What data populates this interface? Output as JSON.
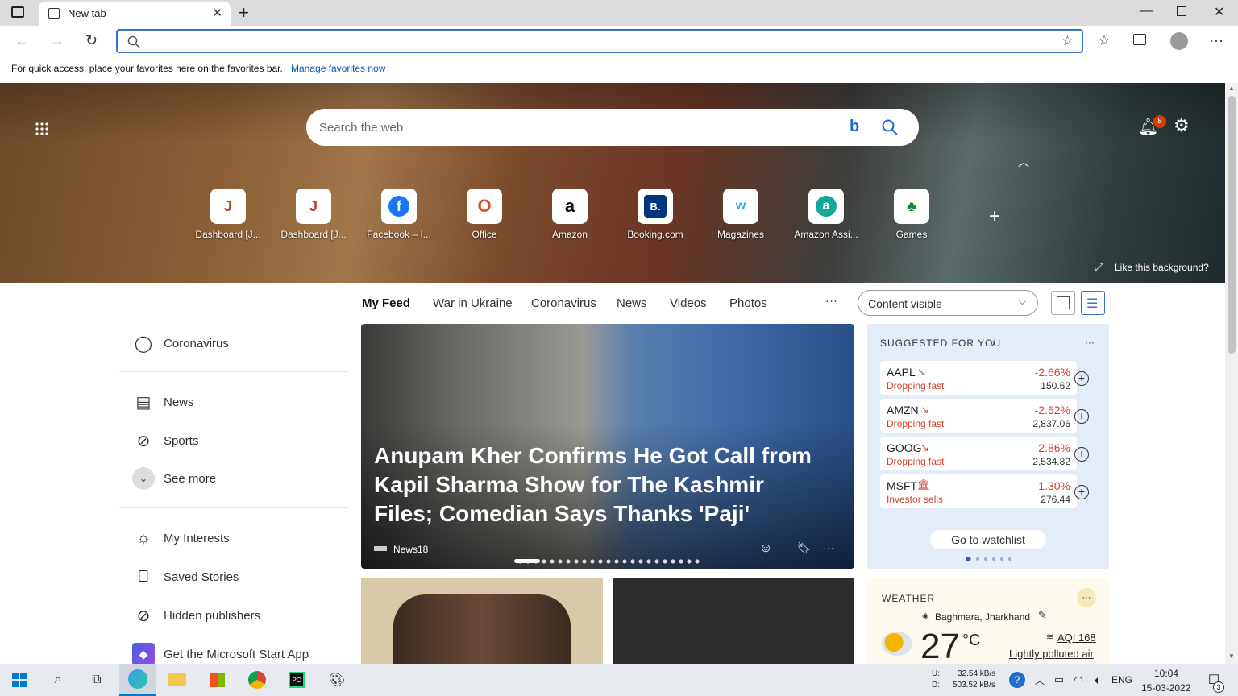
{
  "browser": {
    "tab_title": "New tab",
    "address_value": "",
    "favorites_hint": "For quick access, place your favorites here on the favorites bar.",
    "manage_favorites": "Manage favorites now"
  },
  "hero": {
    "search_placeholder": "Search the web",
    "notification_count": "8",
    "like_background": "Like this background?",
    "quick_links": [
      {
        "name": "Dashboard [J...",
        "icon": "jenkins-icon",
        "color": "#c0392b"
      },
      {
        "name": "Dashboard [J...",
        "icon": "jenkins-icon",
        "color": "#c0392b"
      },
      {
        "name": "Facebook – I...",
        "icon": "facebook-icon",
        "color": "#1877f2"
      },
      {
        "name": "Office",
        "icon": "office-icon",
        "color": "#e64a19"
      },
      {
        "name": "Amazon",
        "icon": "amazon-icon",
        "color": "#111111"
      },
      {
        "name": "Booking.com",
        "icon": "booking-icon",
        "color": "#003580"
      },
      {
        "name": "Magazines",
        "icon": "magazines-icon",
        "color": "#2ca7e0"
      },
      {
        "name": "Amazon Assi...",
        "icon": "amazon-assistant-icon",
        "color": "#14a89b"
      },
      {
        "name": "Games",
        "icon": "games-icon",
        "color": "#108a32"
      }
    ]
  },
  "feed_nav": {
    "tabs": [
      "My Feed",
      "War in Ukraine",
      "Coronavirus",
      "News",
      "Videos",
      "Photos"
    ],
    "more": "···",
    "content_select": "Content visible"
  },
  "sidebar": {
    "items": [
      "Coronavirus",
      "News",
      "Sports",
      "See more",
      "My Interests",
      "Saved Stories",
      "Hidden publishers",
      "Get the Microsoft Start App"
    ]
  },
  "main_story": {
    "headline": "Anupam Kher Confirms He Got Call from Kapil Sharma Show for The Kashmir Files; Comedian Says Thanks 'Paji'",
    "source": "News18",
    "more": "···"
  },
  "stocks": {
    "title": "SUGGESTED FOR YOU",
    "more": "···",
    "items": [
      {
        "ticker": "AAPL",
        "status": "Dropping fast",
        "change": "-2.66%",
        "price": "150.62"
      },
      {
        "ticker": "AMZN",
        "status": "Dropping fast",
        "change": "-2.52%",
        "price": "2,837.06"
      },
      {
        "ticker": "GOOG",
        "status": "Dropping fast",
        "change": "-2.86%",
        "price": "2,534.82"
      },
      {
        "ticker": "MSFT",
        "status": "Investor sells",
        "change": "-1.30%",
        "price": "276.44"
      }
    ],
    "watchlist_button": "Go to watchlist"
  },
  "weather": {
    "title": "WEATHER",
    "location": "Baghmara, Jharkhand",
    "temperature": "27",
    "unit": "°C",
    "aqi": "AQI 168",
    "air": "Lightly polluted air",
    "more": "···"
  },
  "taskbar": {
    "net_up_label": "U:",
    "net_up": "32.54 kB/s",
    "net_down_label": "D:",
    "net_down": "503.52 kB/s",
    "language": "ENG",
    "time": "10:04",
    "date": "15-03-2022",
    "notifications": "3"
  }
}
